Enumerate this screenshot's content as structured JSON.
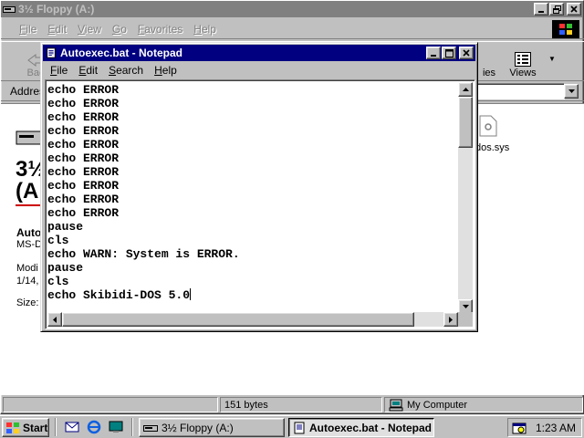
{
  "explorer": {
    "title": "3½ Floppy (A:)",
    "menu": [
      {
        "first": "F",
        "rest": "ile"
      },
      {
        "first": "E",
        "rest": "dit"
      },
      {
        "first": "V",
        "rest": "iew"
      },
      {
        "first": "G",
        "rest": "o"
      },
      {
        "first": "F",
        "rest": "avorites"
      },
      {
        "first": "H",
        "rest": "elp"
      }
    ],
    "toolbar": {
      "back_label": "Bac",
      "views_label": "Views",
      "ies_label": "ies"
    },
    "address_label": "Addres",
    "content": {
      "title_frag_1": "3½",
      "title_frag_2": "(A",
      "name_frag": "Auto",
      "type_frag": "MS-D",
      "modified_frag": "Modi",
      "date_frag": "1/14,",
      "size_frag": "Size:",
      "file_frag": "dos.sys"
    },
    "status": {
      "size": "151 bytes",
      "zone": "My Computer"
    }
  },
  "notepad": {
    "title": "Autoexec.bat - Notepad",
    "menu": [
      {
        "first": "F",
        "rest": "ile"
      },
      {
        "first": "E",
        "rest": "dit"
      },
      {
        "first": "S",
        "rest": "earch"
      },
      {
        "first": "H",
        "rest": "elp"
      }
    ],
    "lines": [
      "echo ERROR",
      "echo ERROR",
      "echo ERROR",
      "echo ERROR",
      "echo ERROR",
      "echo ERROR",
      "echo ERROR",
      "echo ERROR",
      "echo ERROR",
      "echo ERROR",
      "pause",
      "cls",
      "echo WARN: System is ERROR.",
      "pause",
      "cls",
      "echo Skibidi-DOS 5.0"
    ]
  },
  "taskbar": {
    "start_label": "Start",
    "tasks": [
      "3½ Floppy (A:)",
      "Autoexec.bat - Notepad"
    ],
    "clock": "1:23 AM"
  },
  "colors": {
    "active_title": "#000080",
    "inactive_title": "#808080",
    "face": "#c0c0c0"
  }
}
